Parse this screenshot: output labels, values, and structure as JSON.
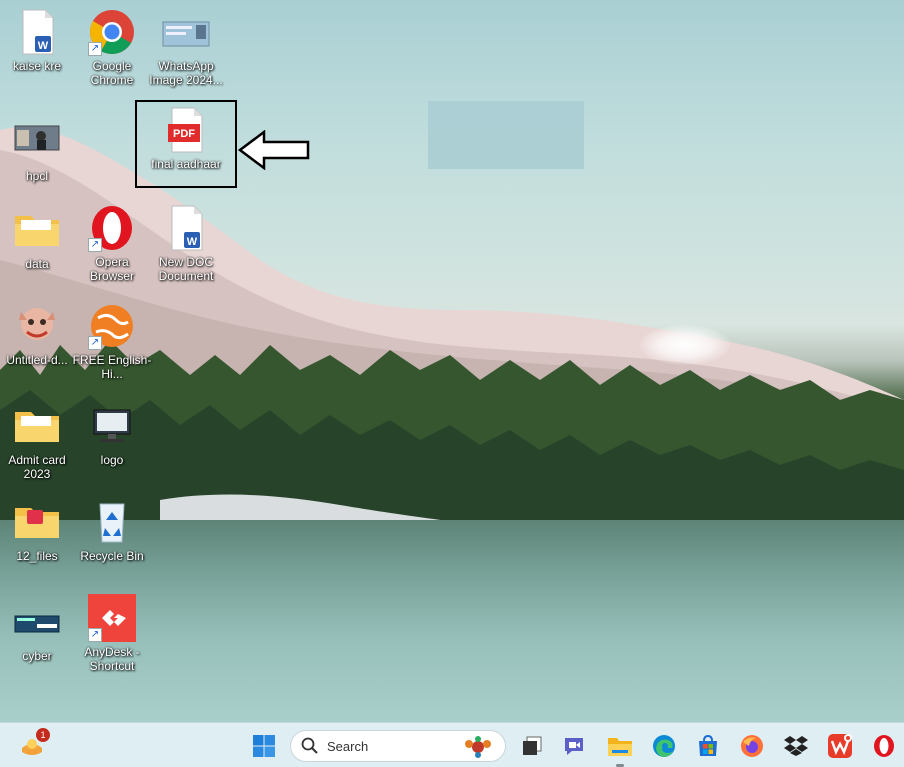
{
  "desktop": {
    "icons": [
      {
        "label": "kaise kre",
        "icon": "word-document-icon"
      },
      {
        "label": "Google Chrome",
        "icon": "chrome-icon"
      },
      {
        "label": "WhatsApp Image 2024...",
        "icon": "image-thumbnail-icon"
      },
      {
        "label": "hpcl",
        "icon": "image-thumbnail-icon"
      },
      {
        "label": "final aadhaar",
        "icon": "pdf-file-icon",
        "badge": "PDF"
      },
      {
        "label": "data",
        "icon": "folder-icon"
      },
      {
        "label": "Opera Browser",
        "icon": "opera-icon"
      },
      {
        "label": "New DOC Document",
        "icon": "word-document-icon"
      },
      {
        "label": "Untitled-d...",
        "icon": "image-thumbnail-icon"
      },
      {
        "label": "FREE English-Hi...",
        "icon": "globe-app-icon"
      },
      {
        "label": "Admit card 2023",
        "icon": "folder-icon"
      },
      {
        "label": "logo",
        "icon": "computer-icon"
      },
      {
        "label": "12_files",
        "icon": "folder-icon"
      },
      {
        "label": "Recycle Bin",
        "icon": "recycle-bin-icon"
      },
      {
        "label": "cyber",
        "icon": "image-thumbnail-icon"
      },
      {
        "label": "AnyDesk - Shortcut",
        "icon": "anydesk-icon"
      }
    ],
    "word_badge": "W"
  },
  "taskbar": {
    "search_label": "Search",
    "widget_badge": "1",
    "items": [
      "start-icon",
      "task-view-icon",
      "meet-icon",
      "file-explorer-icon",
      "edge-icon",
      "store-icon",
      "firefox-icon",
      "dropbox-icon",
      "wps-icon",
      "opera-icon"
    ]
  }
}
